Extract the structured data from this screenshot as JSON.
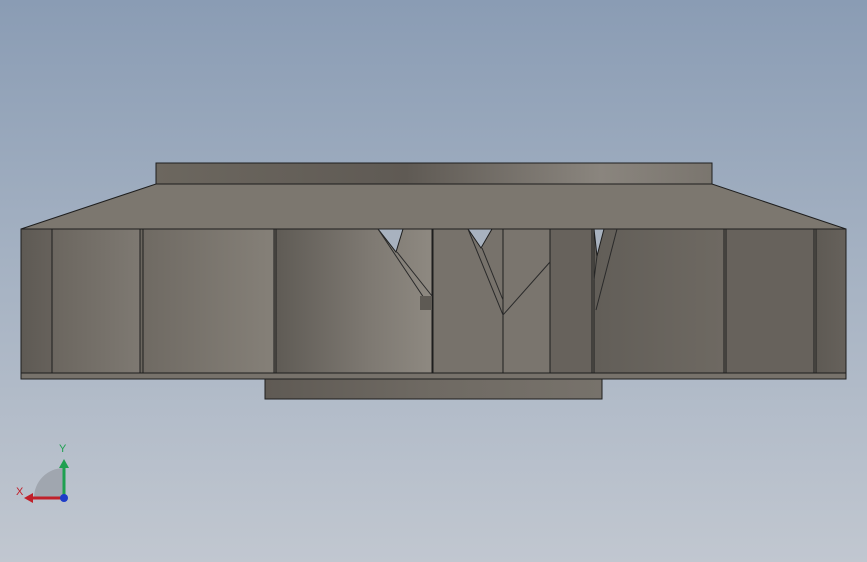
{
  "viewport": {
    "background_top": "#8a9cb4",
    "background_bottom": "#c1c7d0"
  },
  "model": {
    "view": "front",
    "part": "impeller",
    "body_color": "#7f7a73",
    "shadow_color": "#5e5a55",
    "highlight_color": "#8c8780",
    "edge_color": "#1e1e1e"
  },
  "triad": {
    "x_label": "X",
    "y_label": "Y",
    "x_color": "#c0202a",
    "y_color": "#1ea050",
    "z_color": "#1e3cc8"
  }
}
